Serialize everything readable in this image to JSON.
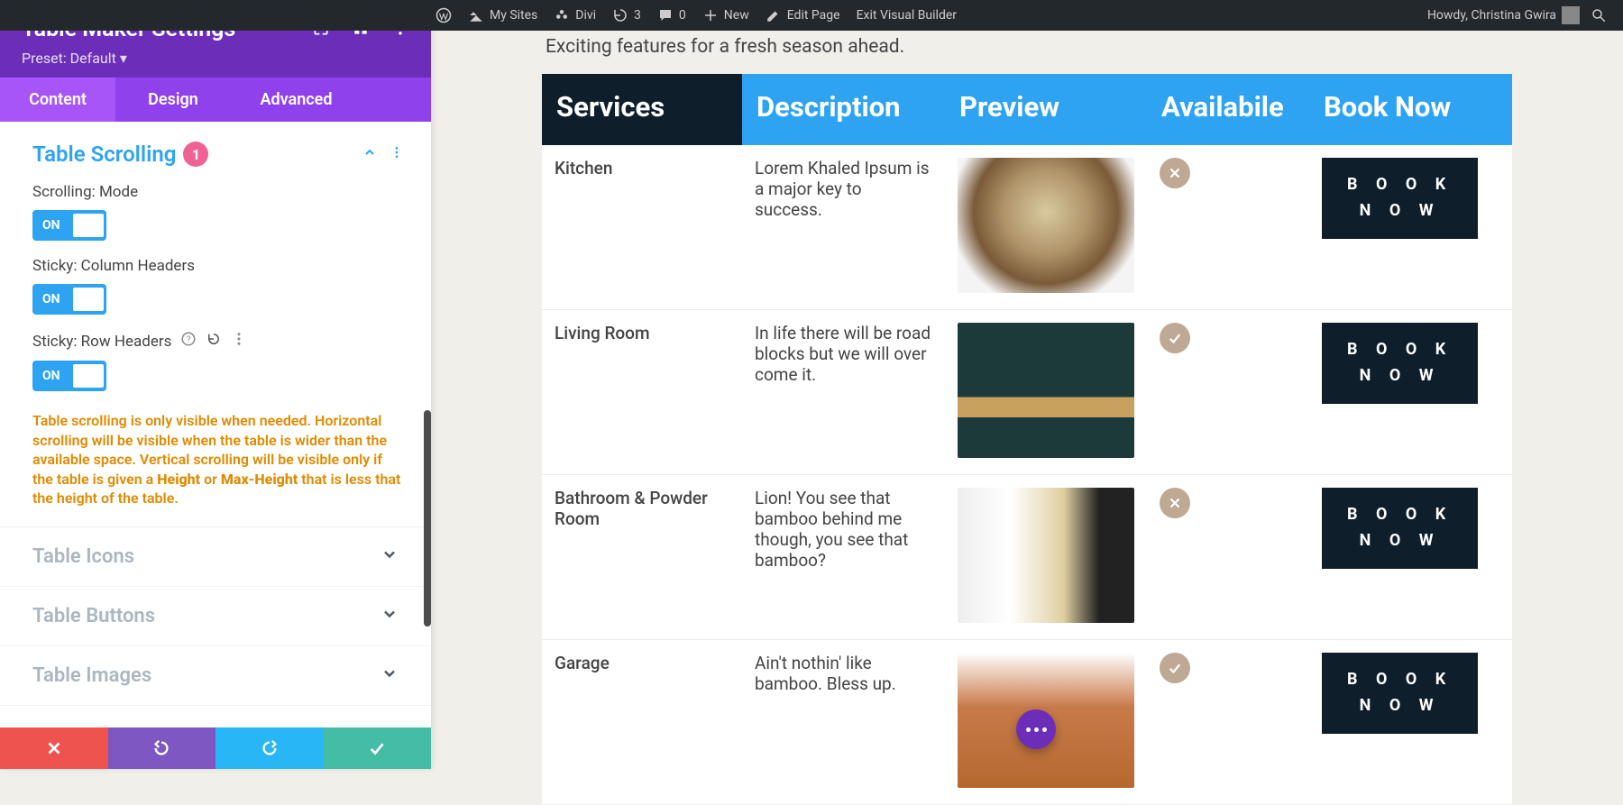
{
  "wpbar": {
    "my_sites": "My Sites",
    "site_name": "Divi",
    "updates_count": "3",
    "comments_count": "0",
    "new": "New",
    "edit_page": "Edit Page",
    "exit_vb": "Exit Visual Builder",
    "howdy": "Howdy, Christina Gwira"
  },
  "sidebar": {
    "title": "Table Maker Settings",
    "preset": "Preset: Default ▾",
    "tabs": {
      "content": "Content",
      "design": "Design",
      "advanced": "Advanced"
    },
    "scroll_section": {
      "title": "Table Scrolling",
      "badge": "1",
      "opt1_label": "Scrolling: Mode",
      "opt2_label": "Sticky: Column Headers",
      "opt3_label": "Sticky: Row Headers",
      "toggle_on": "ON",
      "warn_p1": "Table scrolling is only visible when needed. Horizontal scrolling will be visible when the table is wider than the available space. Vertical scrolling will be visible only if the table is given a ",
      "warn_b1": "Height",
      "warn_p2": " or ",
      "warn_b2": "Max-Height",
      "warn_p3": " that is less that the height of the table."
    },
    "collapsed": {
      "icons": "Table Icons",
      "buttons": "Table Buttons",
      "images": "Table Images"
    }
  },
  "page": {
    "subtitle": "Exciting features for a fresh season ahead."
  },
  "table": {
    "headers": {
      "services": "Services",
      "description": "Description",
      "preview": "Preview",
      "available": "Availabile",
      "book": "Book Now"
    },
    "book_label": "BOOK NOW",
    "rows": [
      {
        "service": "Kitchen",
        "desc": "Lorem Khaled Ipsum is a major key to success.",
        "avail": "x"
      },
      {
        "service": "Living Room",
        "desc": "In life there will be road blocks but we will over come it.",
        "avail": "v"
      },
      {
        "service": "Bathroom & Powder Room",
        "desc": "Lion! You see that bamboo behind me though, you see that bamboo?",
        "avail": "x"
      },
      {
        "service": "Garage",
        "desc": "Ain't nothin' like bamboo. Bless up.",
        "avail": "v"
      }
    ]
  }
}
